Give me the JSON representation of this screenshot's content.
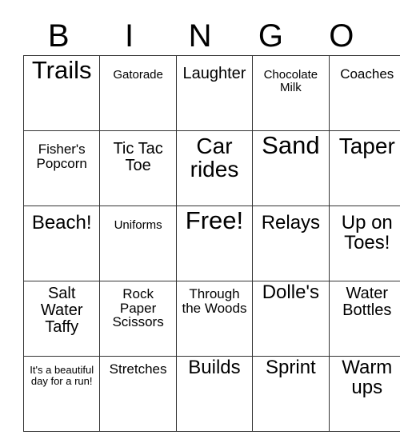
{
  "card": {
    "header_letters": [
      "B",
      "I",
      "N",
      "G",
      "O"
    ],
    "columns": 5,
    "rows": 5,
    "free_space_label": "Free!",
    "colors": {
      "background": "#ffffff",
      "text": "#000000",
      "border": "#333333"
    }
  },
  "grid": {
    "rows": [
      {
        "cells": [
          {
            "text": "Trails",
            "size": "xxl"
          },
          {
            "text": "Gatorade",
            "size": "xs"
          },
          {
            "text": "Laughter",
            "size": "m"
          },
          {
            "text": "Chocolate Milk",
            "size": "xs"
          },
          {
            "text": "Coaches",
            "size": "s"
          }
        ]
      },
      {
        "cells": [
          {
            "text": "Fisher's Popcorn",
            "size": "s"
          },
          {
            "text": "Tic Tac Toe",
            "size": "m"
          },
          {
            "text": "Car rides",
            "size": "xl"
          },
          {
            "text": "Sand",
            "size": "xxl"
          },
          {
            "text": "Taper",
            "size": "xl"
          }
        ]
      },
      {
        "cells": [
          {
            "text": "Beach!",
            "size": "l"
          },
          {
            "text": "Uniforms",
            "size": "xs"
          },
          {
            "text": "Free!",
            "size": "xxl"
          },
          {
            "text": "Relays",
            "size": "l"
          },
          {
            "text": "Up on Toes!",
            "size": "l"
          }
        ]
      },
      {
        "cells": [
          {
            "text": "Salt Water Taffy",
            "size": "m"
          },
          {
            "text": "Rock Paper Scissors",
            "size": "s"
          },
          {
            "text": "Through the Woods",
            "size": "s"
          },
          {
            "text": "Dolle's",
            "size": "l"
          },
          {
            "text": "Water Bottles",
            "size": "m"
          }
        ]
      },
      {
        "cells": [
          {
            "text": "It's a beautiful day for a run!",
            "size": "xxs"
          },
          {
            "text": "Stretches",
            "size": "s"
          },
          {
            "text": "Builds",
            "size": "l"
          },
          {
            "text": "Sprint",
            "size": "l"
          },
          {
            "text": "Warm ups",
            "size": "l"
          }
        ]
      }
    ]
  }
}
